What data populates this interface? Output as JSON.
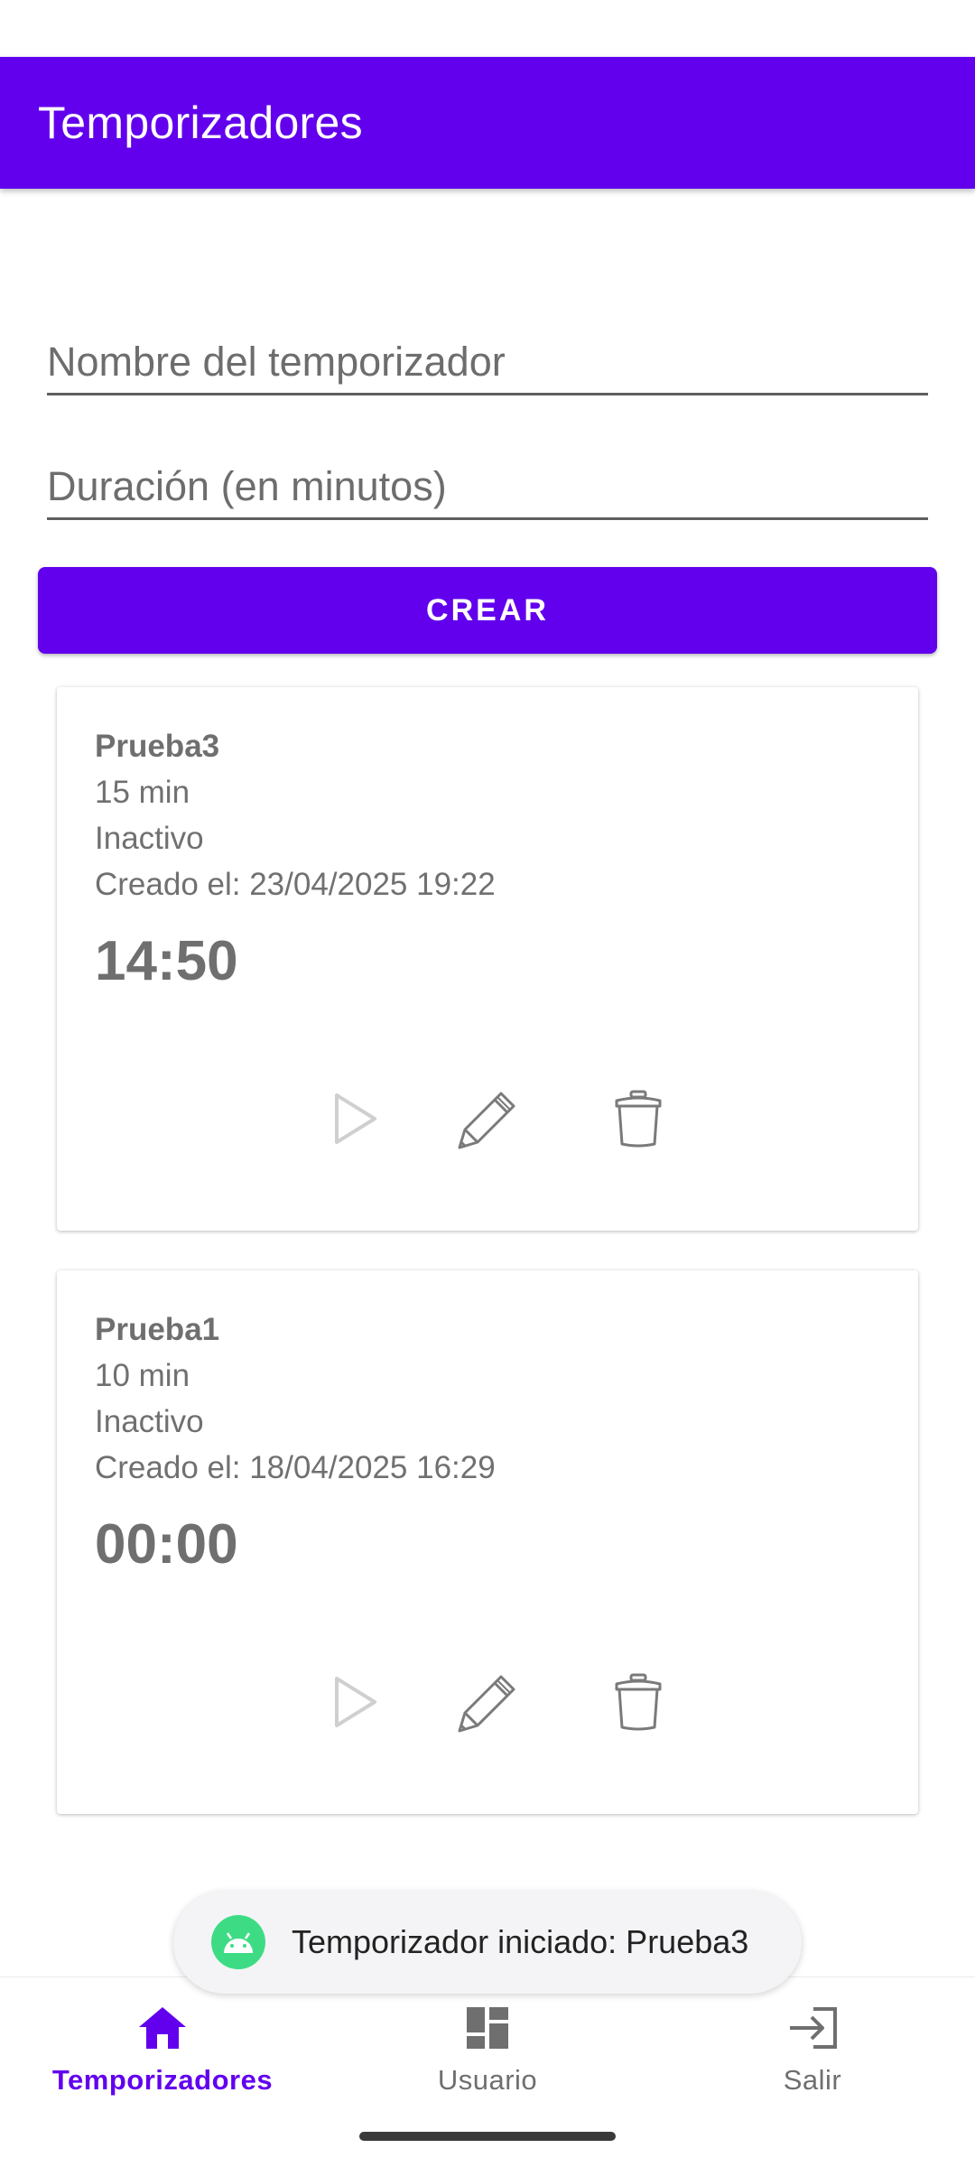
{
  "app_bar": {
    "title": "Temporizadores"
  },
  "form": {
    "name_placeholder": "Nombre del temporizador",
    "duration_placeholder": "Duración (en minutos)",
    "create_label": "CREAR"
  },
  "timers": [
    {
      "name": "Prueba3",
      "duration": "15 min",
      "state": "Inactivo",
      "created": "Creado el: 23/04/2025 19:22",
      "remaining": "14:50"
    },
    {
      "name": "Prueba1",
      "duration": "10 min",
      "state": "Inactivo",
      "created": "Creado el: 18/04/2025 16:29",
      "remaining": "00:00"
    }
  ],
  "card_actions": [
    "play-icon",
    "pencil-icon",
    "trash-icon"
  ],
  "toast": {
    "icon": "android-icon",
    "text": "Temporizador iniciado: Prueba3"
  },
  "bottom_nav": {
    "items": [
      {
        "label": "Temporizadores",
        "icon": "home-icon",
        "active": true
      },
      {
        "label": "Usuario",
        "icon": "dashboard-icon",
        "active": false
      },
      {
        "label": "Salir",
        "icon": "logout-icon",
        "active": false
      }
    ]
  },
  "colors": {
    "primary": "#6200EE",
    "toast_icon": "#3DDC84",
    "text_gray": "#757575"
  }
}
